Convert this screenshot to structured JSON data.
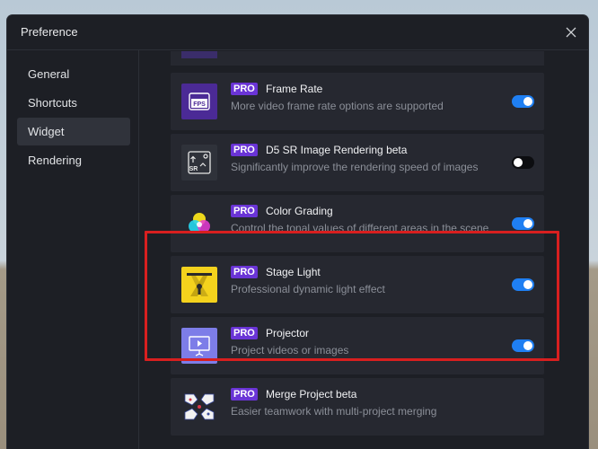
{
  "dialog": {
    "title": "Preference"
  },
  "sidebar": {
    "items": [
      {
        "label": "General",
        "active": false
      },
      {
        "label": "Shortcuts",
        "active": false
      },
      {
        "label": "Widget",
        "active": true
      },
      {
        "label": "Rendering",
        "active": false
      }
    ]
  },
  "widgets": [
    {
      "badge": "PRO",
      "name": "Frame Rate",
      "desc": "More video frame rate options are supported",
      "enabled": true,
      "icon": "fps-icon"
    },
    {
      "badge": "PRO",
      "name": "D5 SR Image Rendering beta",
      "desc": "Significantly improve the rendering speed of images",
      "enabled": false,
      "icon": "sr-icon"
    },
    {
      "badge": "PRO",
      "name": "Color Grading",
      "desc": "Control the tonal values of different areas in the scene",
      "enabled": true,
      "icon": "color-grading-icon"
    },
    {
      "badge": "PRO",
      "name": "Stage Light",
      "desc": "Professional dynamic light effect",
      "enabled": true,
      "icon": "stage-light-icon"
    },
    {
      "badge": "PRO",
      "name": "Projector",
      "desc": "Project videos or images",
      "enabled": true,
      "icon": "projector-icon"
    },
    {
      "badge": "PRO",
      "name": "Merge Project beta",
      "desc": "Easier teamwork with multi-project merging",
      "enabled": true,
      "icon": "merge-project-icon"
    }
  ],
  "colors": {
    "accent": "#1f7ff2",
    "pro_badge": "#6a34d6",
    "highlight": "#d81f1f"
  }
}
